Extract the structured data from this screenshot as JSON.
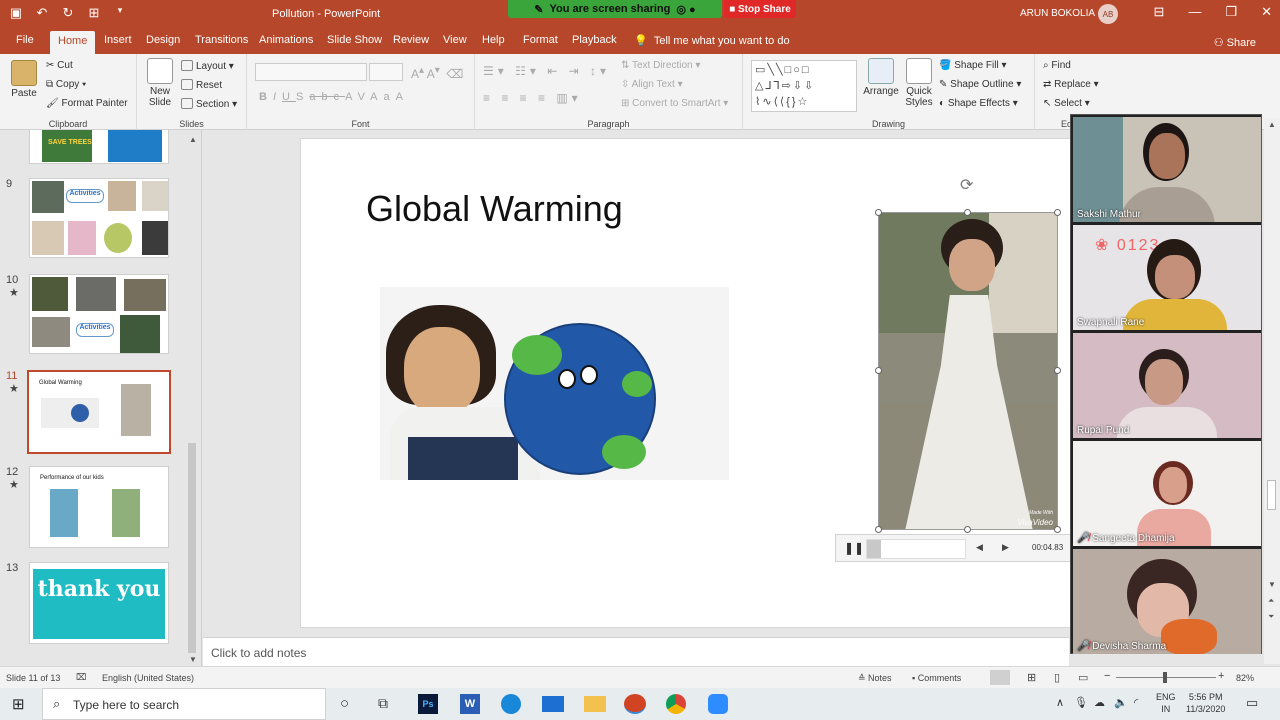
{
  "app": {
    "doc_title": "Pollution  -  PowerPoint",
    "user_name": "ARUN BOKOLIA",
    "user_initials": "AB",
    "share_banner": "You are screen sharing",
    "stop_share": "Stop Share"
  },
  "tabs": [
    "File",
    "Home",
    "Insert",
    "Design",
    "Transitions",
    "Animations",
    "Slide Show",
    "Review",
    "View",
    "Help",
    "Format",
    "Playback"
  ],
  "tell_me": "Tell me what you want to do",
  "share_label": "Share",
  "ribbon": {
    "clipboard": {
      "paste": "Paste",
      "cut": "Cut",
      "copy": "Copy",
      "format_painter": "Format Painter",
      "label": "Clipboard"
    },
    "slides": {
      "new_slide": "New Slide",
      "layout": "Layout",
      "reset": "Reset",
      "section": "Section",
      "label": "Slides"
    },
    "font": {
      "label": "Font",
      "bold": "B",
      "italic": "I",
      "underline": "U",
      "shadow": "S",
      "strike": "abc",
      "spacing": "AV",
      "case": "Aa",
      "color": "A"
    },
    "paragraph": {
      "text_direction": "Text Direction",
      "align_text": "Align Text",
      "convert": "Convert to SmartArt",
      "label": "Paragraph"
    },
    "drawing": {
      "arrange": "Arrange",
      "quick_styles": "Quick Styles",
      "shape_fill": "Shape Fill",
      "shape_outline": "Shape Outline",
      "shape_effects": "Shape Effects",
      "label": "Drawing"
    },
    "editing": {
      "find": "Find",
      "replace": "Replace",
      "select": "Select",
      "label": "Editing"
    }
  },
  "thumbnails": [
    {
      "num": "9",
      "star": ""
    },
    {
      "num": "10",
      "star": "★"
    },
    {
      "num": "11",
      "star": "★",
      "title": "Global Warming"
    },
    {
      "num": "12",
      "star": "★",
      "title": "Performance of our kids"
    },
    {
      "num": "13",
      "star": "",
      "title": "thank you"
    }
  ],
  "thumb_labels": {
    "activities": "Activities",
    "save_trees": "SAVE TREES"
  },
  "slide": {
    "title": "Global Warming",
    "video_watermark_line1": "Made With",
    "video_watermark_line2": "VivaVideo",
    "player_time": "00:04.83"
  },
  "notes_placeholder": "Click to add notes",
  "status": {
    "slide_of": "Slide 11 of 13",
    "language": "English (United States)",
    "notes": "Notes",
    "comments": "Comments",
    "zoom": "82%"
  },
  "participants": [
    "Sakshi Mathur",
    "Swapnali Rane",
    "Rupal Pund",
    "Sangeeta Dhamija",
    "Devisha Sharma"
  ],
  "taskbar": {
    "search": "Type here to search",
    "lang1": "ENG",
    "lang2": "IN",
    "time": "5:56 PM",
    "date": "11/3/2020"
  },
  "colors": {
    "accent": "#b7472a",
    "share_green": "#3aa53a",
    "stop_red": "#e02828"
  }
}
